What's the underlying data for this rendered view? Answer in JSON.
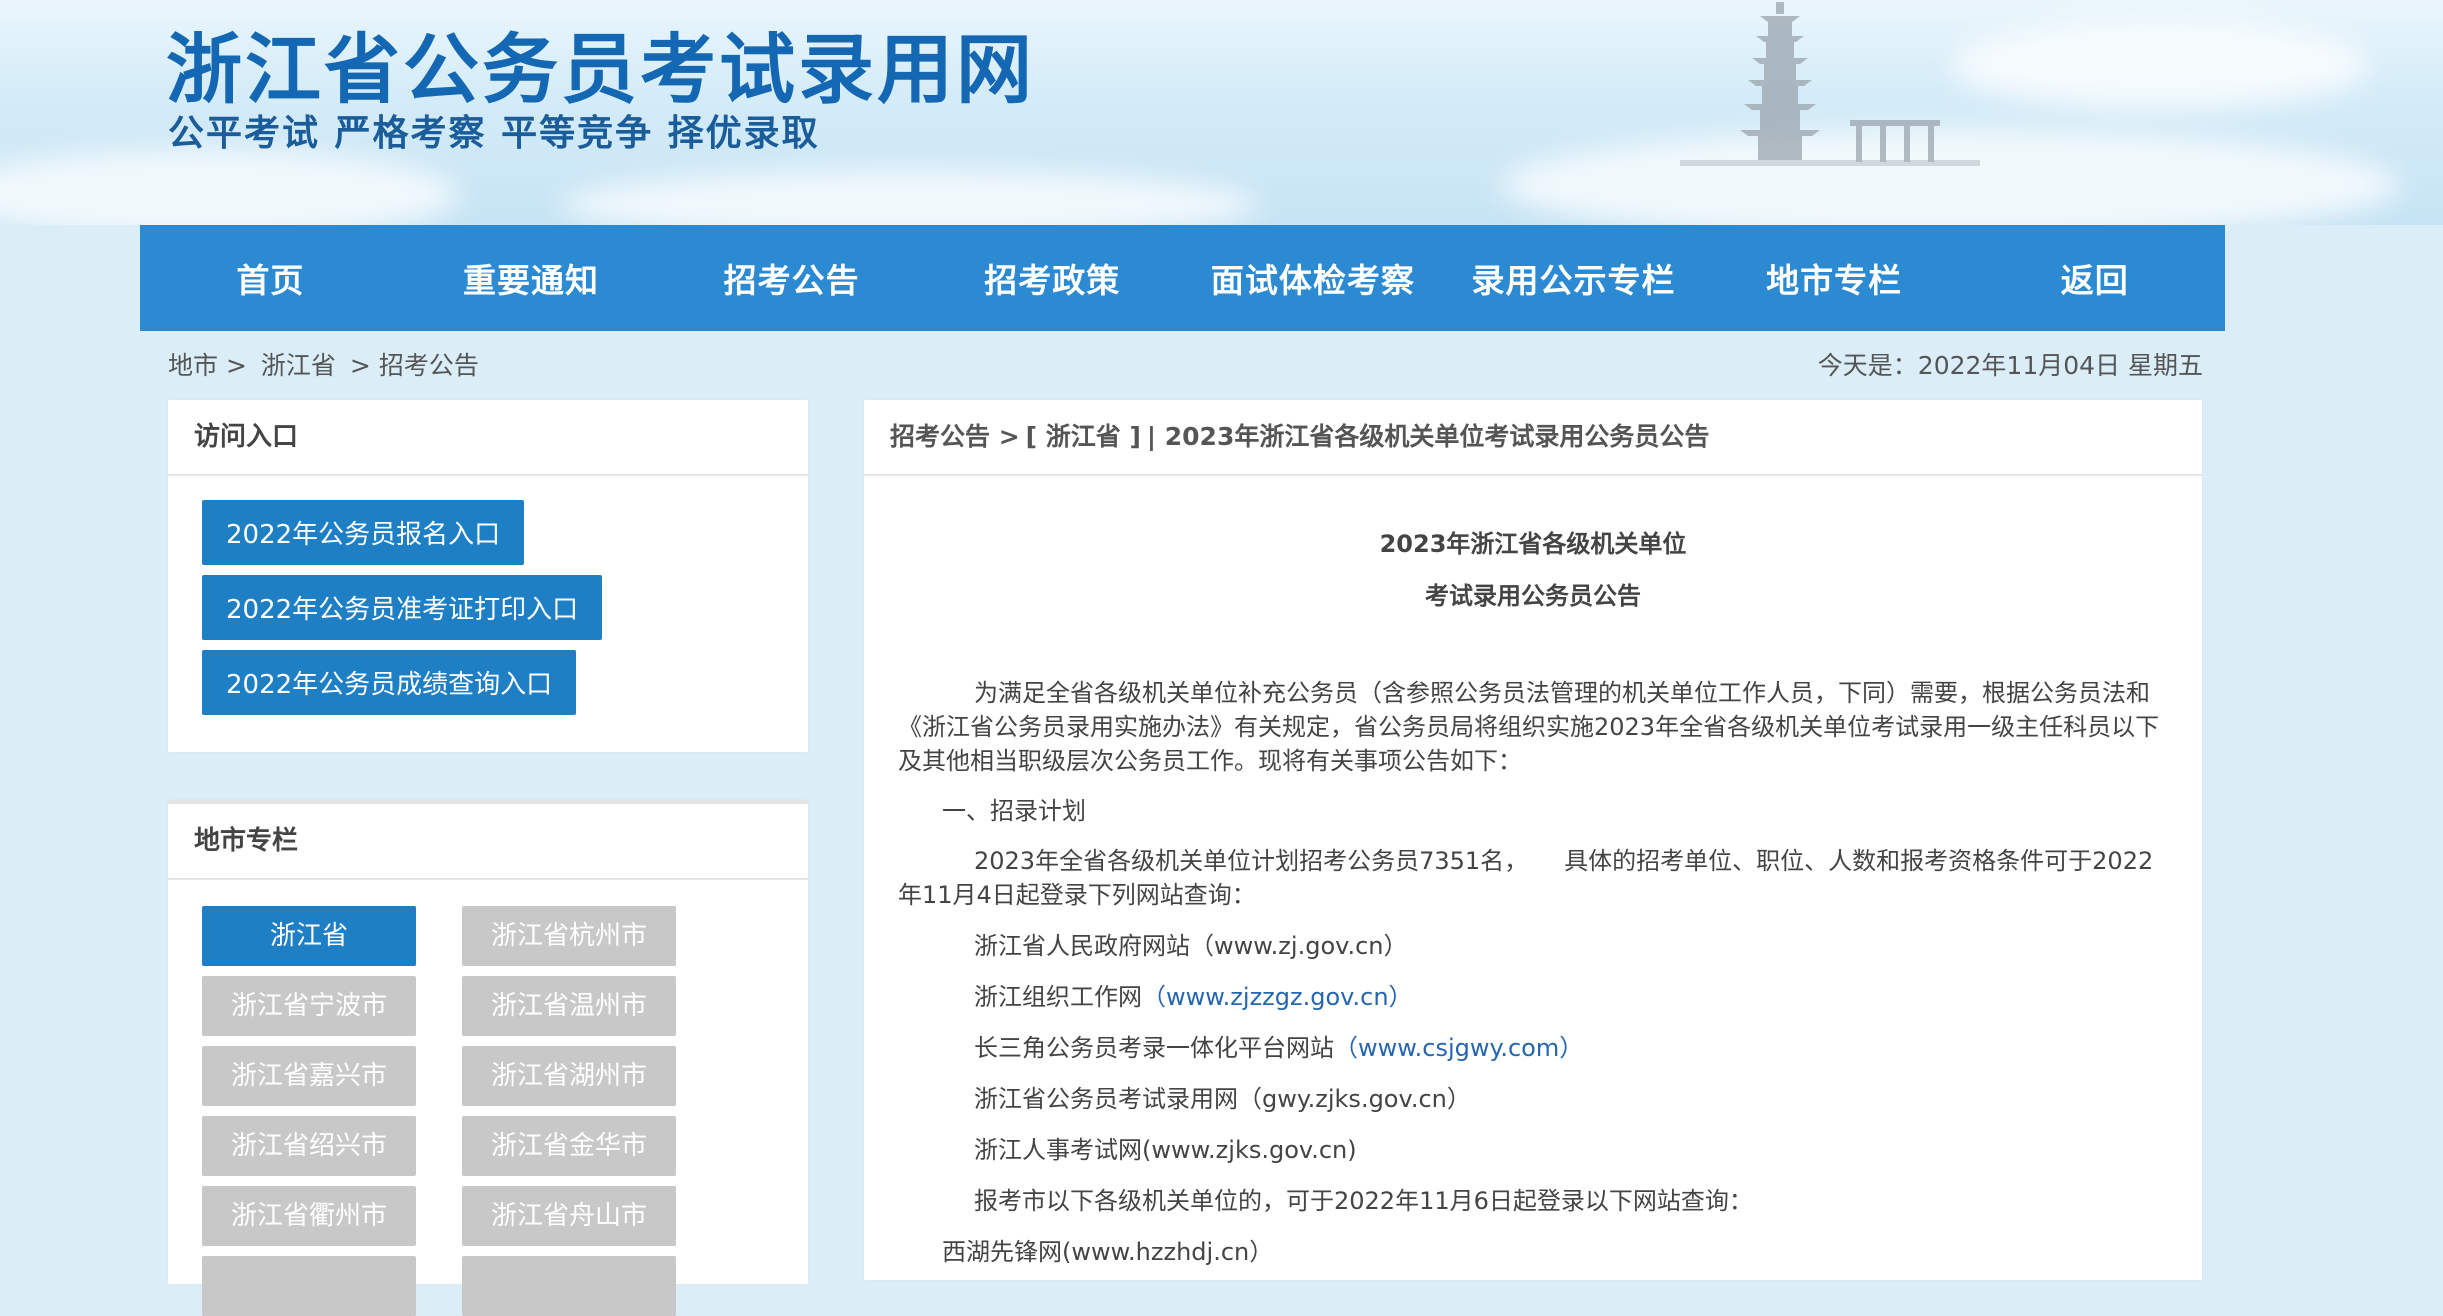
{
  "header": {
    "title": "浙江省公务员考试录用网",
    "slogan": "公平考试 严格考察 平等竞争 择优录取"
  },
  "nav": [
    "首页",
    "重要通知",
    "招考公告",
    "招考政策",
    "面试体检考察",
    "录用公示专栏",
    "地市专栏",
    "返回"
  ],
  "breadcrumb": [
    "地市 >",
    "浙江省",
    "> 招考公告"
  ],
  "today": "今天是：2022年11月04日 星期五",
  "access": {
    "heading": "访问入口",
    "buttons": [
      "2022年公务员报名入口",
      "2022年公务员准考证打印入口",
      "2022年公务员成绩查询入口"
    ]
  },
  "cities": {
    "heading": "地市专栏",
    "items": [
      "浙江省",
      "浙江省杭州市",
      "浙江省宁波市",
      "浙江省温州市",
      "浙江省嘉兴市",
      "浙江省湖州市",
      "浙江省绍兴市",
      "浙江省金华市",
      "浙江省衢州市",
      "浙江省舟山市"
    ],
    "active_index": 0
  },
  "article": {
    "path": [
      "招考公告 >",
      "[ 浙江省 ]",
      "| 2023年浙江省各级机关单位考试录用公务员公告"
    ],
    "title_line1": "2023年浙江省各级机关单位",
    "title_line2": "考试录用公务员公告",
    "intro": "为满足全省各级机关单位补充公务员（含参照公务员法管理的机关单位工作人员，下同）需要，根据公务员法和《浙江省公务员录用实施办法》有关规定，省公务员局将组织实施2023年全省各级机关单位考试录用一级主任科员以下及其他相当职级层次公务员工作。现将有关事项公告如下：",
    "section1": "一、招录计划",
    "plan": "2023年全省各级机关单位计划招考公务员7351名，　　具体的招考单位、职位、人数和报考资格条件可于2022年11月4日起登录下列网站查询：",
    "sites": [
      {
        "name": "浙江省人民政府网站",
        "url": "（www.zj.gov.cn）",
        "is_link": false
      },
      {
        "name": "浙江组织工作网",
        "url": "（www.zjzzgz.gov.cn）",
        "is_link": true
      },
      {
        "name": "长三角公务员考录一体化平台网站",
        "url": "（www.csjgwy.com）",
        "is_link": true
      },
      {
        "name": "浙江省公务员考试录用网",
        "url": "（gwy.zjks.gov.cn）",
        "is_link": false
      },
      {
        "name": "浙江人事考试网",
        "url": "(www.zjks.gov.cn)",
        "is_link": false
      }
    ],
    "city_note": "报考市以下各级机关单位的，可于2022年11月6日起登录以下网站查询：",
    "city_site": "西湖先锋网(www.hzzhdj.cn）"
  },
  "colors": {
    "nav_bg": "#2c8ad3",
    "title": "#1467b3",
    "button_active": "#1f7fc5",
    "button_inactive": "#c8c8c8",
    "link": "#2566b0"
  }
}
